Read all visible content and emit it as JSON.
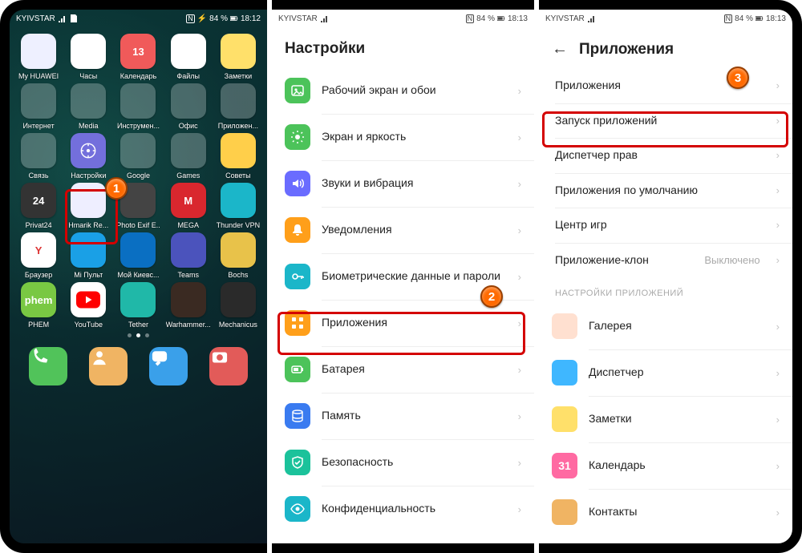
{
  "statusbar": {
    "carrier": "KYIVSTAR",
    "battery": "84 %",
    "time_p1": "18:12",
    "time_p2": "18:13",
    "time_p3": "18:13"
  },
  "markers": {
    "m1": "1",
    "m2": "2",
    "m3": "3"
  },
  "home": {
    "apps_row1": [
      {
        "label": "My HUAWEI",
        "bg": "#eef0ff"
      },
      {
        "label": "Часы",
        "bg": "#ffffff"
      },
      {
        "label": "Календарь",
        "bg": "#f05a5a",
        "text": "13"
      },
      {
        "label": "Файлы",
        "bg": "#ffffff"
      },
      {
        "label": "Заметки",
        "bg": "#ffe06a"
      }
    ],
    "apps_row2": [
      {
        "label": "Интернет",
        "folder": true
      },
      {
        "label": "Media",
        "folder": true
      },
      {
        "label": "Инструмен...",
        "folder": true
      },
      {
        "label": "Офис",
        "folder": true
      },
      {
        "label": "Приложен...",
        "folder": true
      }
    ],
    "apps_row3": [
      {
        "label": "Связь",
        "folder": true
      },
      {
        "label": "Настройки",
        "bg": "#736fdc"
      },
      {
        "label": "Google",
        "folder": true
      },
      {
        "label": "Games",
        "folder": true
      },
      {
        "label": "Советы",
        "bg": "#ffcf4a"
      }
    ],
    "apps_row4": [
      {
        "label": "Privat24",
        "bg": "#333",
        "text": "24"
      },
      {
        "label": "Hmarik Re...",
        "bg": "#eef"
      },
      {
        "label": "Photo Exif E..",
        "bg": "#444"
      },
      {
        "label": "MEGA",
        "bg": "#d9272e",
        "text": "M"
      },
      {
        "label": "Thunder VPN",
        "bg": "#1bb6c9"
      }
    ],
    "apps_row5": [
      {
        "label": "Браузер",
        "bg": "#fff",
        "text": "Y"
      },
      {
        "label": "Mi Пульт",
        "bg": "#1aa0e6"
      },
      {
        "label": "Мой Киевс...",
        "bg": "#0a6fc2"
      },
      {
        "label": "Teams",
        "bg": "#4b53bc"
      },
      {
        "label": "Bochs",
        "bg": "#e8c24a"
      }
    ],
    "apps_row6": [
      {
        "label": "PHEM",
        "bg": "#79c843",
        "text": "phem"
      },
      {
        "label": "YouTube",
        "bg": "#fff"
      },
      {
        "label": "Tether",
        "bg": "#20b8a8"
      },
      {
        "label": "Warhammer...",
        "bg": "#3a2a22"
      },
      {
        "label": "Mechanicus",
        "bg": "#2a2a2a"
      }
    ],
    "dock": [
      {
        "name": "phone",
        "bg": "#51c35a"
      },
      {
        "name": "contacts",
        "bg": "#f0b463"
      },
      {
        "name": "messages",
        "bg": "#3aa0ea"
      },
      {
        "name": "camera",
        "bg": "#e25b59"
      }
    ]
  },
  "settings": {
    "title": "Настройки",
    "items": [
      {
        "label": "Рабочий экран и обои",
        "color": "#4cc35a",
        "icon": "image"
      },
      {
        "label": "Экран и яркость",
        "color": "#4cc35a",
        "icon": "sun"
      },
      {
        "label": "Звуки и вибрация",
        "color": "#6a6cff",
        "icon": "volume"
      },
      {
        "label": "Уведомления",
        "color": "#ff9f1a",
        "icon": "bell"
      },
      {
        "label": "Биометрические данные и пароли",
        "color": "#1bb6c9",
        "icon": "key",
        "multi": true
      },
      {
        "label": "Приложения",
        "color": "#ff9f1a",
        "icon": "grid"
      },
      {
        "label": "Батарея",
        "color": "#4cc35a",
        "icon": "battery"
      },
      {
        "label": "Память",
        "color": "#3a7bf0",
        "icon": "storage"
      },
      {
        "label": "Безопасность",
        "color": "#1bc29b",
        "icon": "shield"
      },
      {
        "label": "Конфиденциальность",
        "color": "#1bb6c9",
        "icon": "eye"
      }
    ]
  },
  "apps_panel": {
    "title": "Приложения",
    "rows": [
      {
        "label": "Приложения"
      },
      {
        "label": "Запуск приложений"
      },
      {
        "label": "Диспетчер прав"
      },
      {
        "label": "Приложения по умолчанию"
      },
      {
        "label": "Центр игр"
      },
      {
        "label": "Приложение-клон",
        "sub": "Выключено"
      }
    ],
    "group": "НАСТРОЙКИ ПРИЛОЖЕНИЙ",
    "app_rows": [
      {
        "label": "Галерея",
        "bg": "#ffe0d0"
      },
      {
        "label": "Диспетчер",
        "bg": "#3fb7ff"
      },
      {
        "label": "Заметки",
        "bg": "#ffe06a"
      },
      {
        "label": "Календарь",
        "bg": "#ff6aa2",
        "text": "31"
      },
      {
        "label": "Контакты",
        "bg": "#f0b463"
      }
    ]
  }
}
